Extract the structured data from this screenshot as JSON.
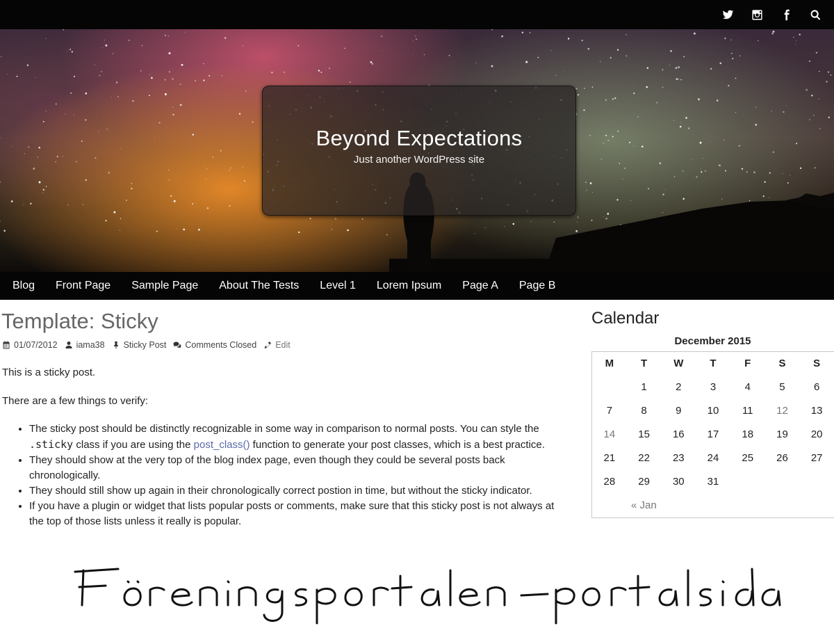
{
  "topbar": {
    "icons": [
      "twitter-icon",
      "instagram-icon",
      "facebook-icon",
      "search-icon"
    ]
  },
  "hero": {
    "site_title": "Beyond Expectations",
    "tagline": "Just another WordPress site"
  },
  "nav": {
    "items": [
      "Blog",
      "Front Page",
      "Sample Page",
      "About The Tests",
      "Level 1",
      "Lorem Ipsum",
      "Page A",
      "Page B"
    ]
  },
  "post": {
    "title": "Template: Sticky",
    "meta": {
      "date": "01/07/2012",
      "author": "iama38",
      "sticky": "Sticky Post",
      "comments": "Comments Closed",
      "edit": "Edit"
    },
    "p1": "This is a sticky post.",
    "p2": "There are a few things to verify:",
    "bullets": {
      "b1_part1": "The sticky post should be distinctly recognizable in some way in comparison to normal posts. You can style the ",
      "b1_code": ".sticky",
      "b1_part2": " class if you are using the ",
      "b1_link": "post_class()",
      "b1_part3": " function to generate your post classes, which is a best practice.",
      "b2": "They should show at the very top of the blog index page, even though they could be several posts back chronologically.",
      "b3": "They should still show up again in their chronologically correct postion in time, but without the sticky indicator.",
      "b4": "If you have a plugin or widget that lists popular posts or comments, make sure that this sticky post is not always at the top of those lists unless it really is popular."
    }
  },
  "sidebar": {
    "widget_title": "Calendar",
    "calendar": {
      "caption": "December 2015",
      "weekdays": [
        "M",
        "T",
        "W",
        "T",
        "F",
        "S",
        "S"
      ],
      "weeks": [
        [
          "",
          "1",
          "2",
          "3",
          "4",
          "5",
          "6"
        ],
        [
          "7",
          "8",
          "9",
          "10",
          "11",
          "12",
          "13"
        ],
        [
          "14",
          "15",
          "16",
          "17",
          "18",
          "19",
          "20"
        ],
        [
          "21",
          "22",
          "23",
          "24",
          "25",
          "26",
          "27"
        ],
        [
          "28",
          "29",
          "30",
          "31",
          "",
          "",
          ""
        ]
      ],
      "prev_link": "« Jan"
    }
  },
  "overlay": {
    "caption": "Föreningsportalen -portalsida"
  }
}
